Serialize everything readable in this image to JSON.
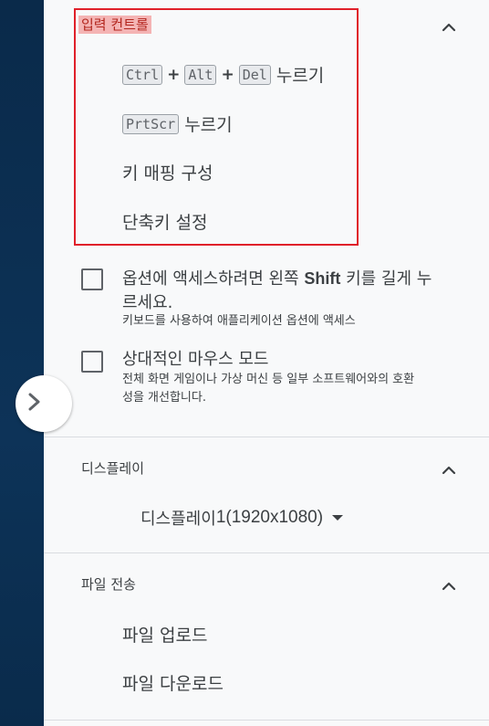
{
  "input_controls": {
    "title": "입력 컨트롤",
    "ctrl_alt_del": {
      "keys": [
        "Ctrl",
        "Alt",
        "Del"
      ],
      "plus": "+",
      "action": "누르기"
    },
    "prtscr": {
      "key": "PrtScr",
      "action": "누르기"
    },
    "key_mapping": "키 매핑 구성",
    "shortcut_settings": "단축키 설정"
  },
  "options": {
    "shift_access": {
      "label_before": "옵션에 액세스하려면 왼쪽",
      "label_shift": "Shift",
      "label_after": "키를 길게 누",
      "label_line2": "르세요.",
      "desc": "키보드를 사용하여 애플리케이션 옵션에 액세스",
      "checked": false
    },
    "relative_mouse": {
      "label": "상대적인 마우스 모드",
      "desc_line1": "전체 화면 게임이나 가상 머신 등 일부 소프트웨어와의 호환",
      "desc_line2": "성을 개선합니다.",
      "checked": false
    }
  },
  "display": {
    "title": "디스플레이",
    "selected_prefix": "디스플레이 ",
    "selected_value": "1(1920x1080)"
  },
  "file_transfer": {
    "title": "파일 전송",
    "upload": "파일 업로드",
    "download": "파일 다운로드"
  },
  "icons": {
    "collapse": "chevron-up-icon",
    "expand_panel": "chevron-right-icon",
    "dropdown": "caret-down-icon"
  },
  "colors": {
    "panel_bg": "#f8f9fa",
    "sidebar_bg": "#0c2f52",
    "highlight_bg": "#f4b4b4",
    "annotation_red": "#e0202a",
    "text": "#3c4043",
    "divider": "#dadce0"
  }
}
